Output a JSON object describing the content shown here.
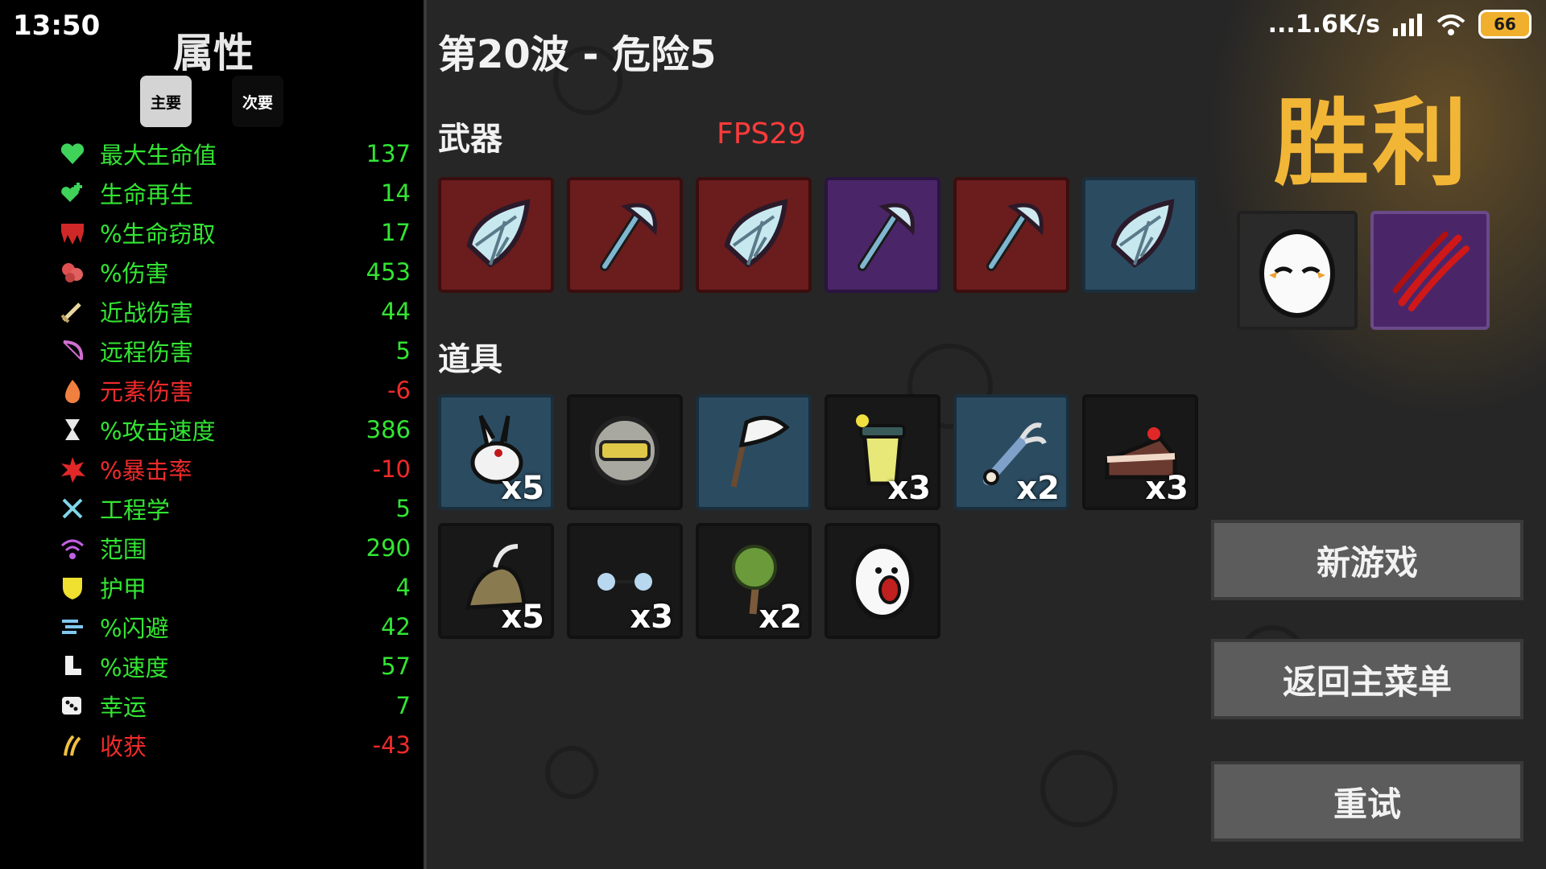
{
  "status_bar": {
    "time": "13:50",
    "network": "...1.6K/s",
    "battery": "66"
  },
  "stats_panel": {
    "title": "属性",
    "tabs": {
      "primary": "主要",
      "secondary": "次要"
    },
    "stats": [
      {
        "icon": "heart-icon",
        "label": "最大生命值",
        "value": "137",
        "status": "positive"
      },
      {
        "icon": "regen-icon",
        "label": "生命再生",
        "value": "14",
        "status": "positive"
      },
      {
        "icon": "lifesteal-icon",
        "label": "%生命窃取",
        "value": "17",
        "status": "positive"
      },
      {
        "icon": "damage-icon",
        "label": "%伤害",
        "value": "453",
        "status": "positive"
      },
      {
        "icon": "sword-icon",
        "label": "近战伤害",
        "value": "44",
        "status": "positive"
      },
      {
        "icon": "bow-icon",
        "label": "远程伤害",
        "value": "5",
        "status": "positive"
      },
      {
        "icon": "flame-icon",
        "label": "元素伤害",
        "value": "-6",
        "status": "negative"
      },
      {
        "icon": "hourglass-icon",
        "label": "%攻击速度",
        "value": "386",
        "status": "positive"
      },
      {
        "icon": "crit-icon",
        "label": "%暴击率",
        "value": "-10",
        "status": "negative"
      },
      {
        "icon": "wrench-icon",
        "label": "工程学",
        "value": "5",
        "status": "positive"
      },
      {
        "icon": "range-icon",
        "label": "范围",
        "value": "290",
        "status": "positive"
      },
      {
        "icon": "shield-icon",
        "label": "护甲",
        "value": "4",
        "status": "positive"
      },
      {
        "icon": "dodge-icon",
        "label": "%闪避",
        "value": "42",
        "status": "positive"
      },
      {
        "icon": "boot-icon",
        "label": "%速度",
        "value": "57",
        "status": "positive"
      },
      {
        "icon": "dice-icon",
        "label": "幸运",
        "value": "7",
        "status": "positive"
      },
      {
        "icon": "harvest-icon",
        "label": "收获",
        "value": "-43",
        "status": "negative"
      }
    ]
  },
  "wave": {
    "title": "第20波 - 危险5"
  },
  "fps": "FPS29",
  "weapons": {
    "label": "武器",
    "items": [
      {
        "icon": "shard-icon",
        "tier": "red"
      },
      {
        "icon": "axe-icon",
        "tier": "red"
      },
      {
        "icon": "shard-icon",
        "tier": "red"
      },
      {
        "icon": "axe-icon",
        "tier": "purple"
      },
      {
        "icon": "axe-icon",
        "tier": "red"
      },
      {
        "icon": "shard-icon",
        "tier": "blue"
      }
    ]
  },
  "items": {
    "label": "道具",
    "list": [
      {
        "icon": "rabbit-icon",
        "tier": "blue",
        "qty": "x5"
      },
      {
        "icon": "helmet-icon",
        "tier": "dark",
        "qty": ""
      },
      {
        "icon": "flag-icon",
        "tier": "blue",
        "qty": ""
      },
      {
        "icon": "lemonade-icon",
        "tier": "dark",
        "qty": "x3"
      },
      {
        "icon": "claw-icon",
        "tier": "blue",
        "qty": "x2"
      },
      {
        "icon": "cake-icon",
        "tier": "dark",
        "qty": "x3"
      },
      {
        "icon": "snail-icon",
        "tier": "dark",
        "qty": "x5"
      },
      {
        "icon": "glasses-icon",
        "tier": "dark",
        "qty": "x3"
      },
      {
        "icon": "tree-icon",
        "tier": "dark",
        "qty": "x2"
      },
      {
        "icon": "screaming-egg-icon",
        "tier": "dark",
        "qty": ""
      }
    ]
  },
  "victory": {
    "title": "胜利",
    "character_icon": "egg-character-icon",
    "perk_icon": "claw-marks-icon"
  },
  "buttons": {
    "new_game": "新游戏",
    "main_menu": "返回主菜单",
    "retry": "重试"
  },
  "colors": {
    "positive": "#33e533",
    "negative": "#f02a2a",
    "victory": "#f2b637",
    "fps": "#ff3a3a",
    "tier_red": "#6b1c1c",
    "tier_purple": "#4a2668",
    "tier_blue": "#2b4b60"
  }
}
